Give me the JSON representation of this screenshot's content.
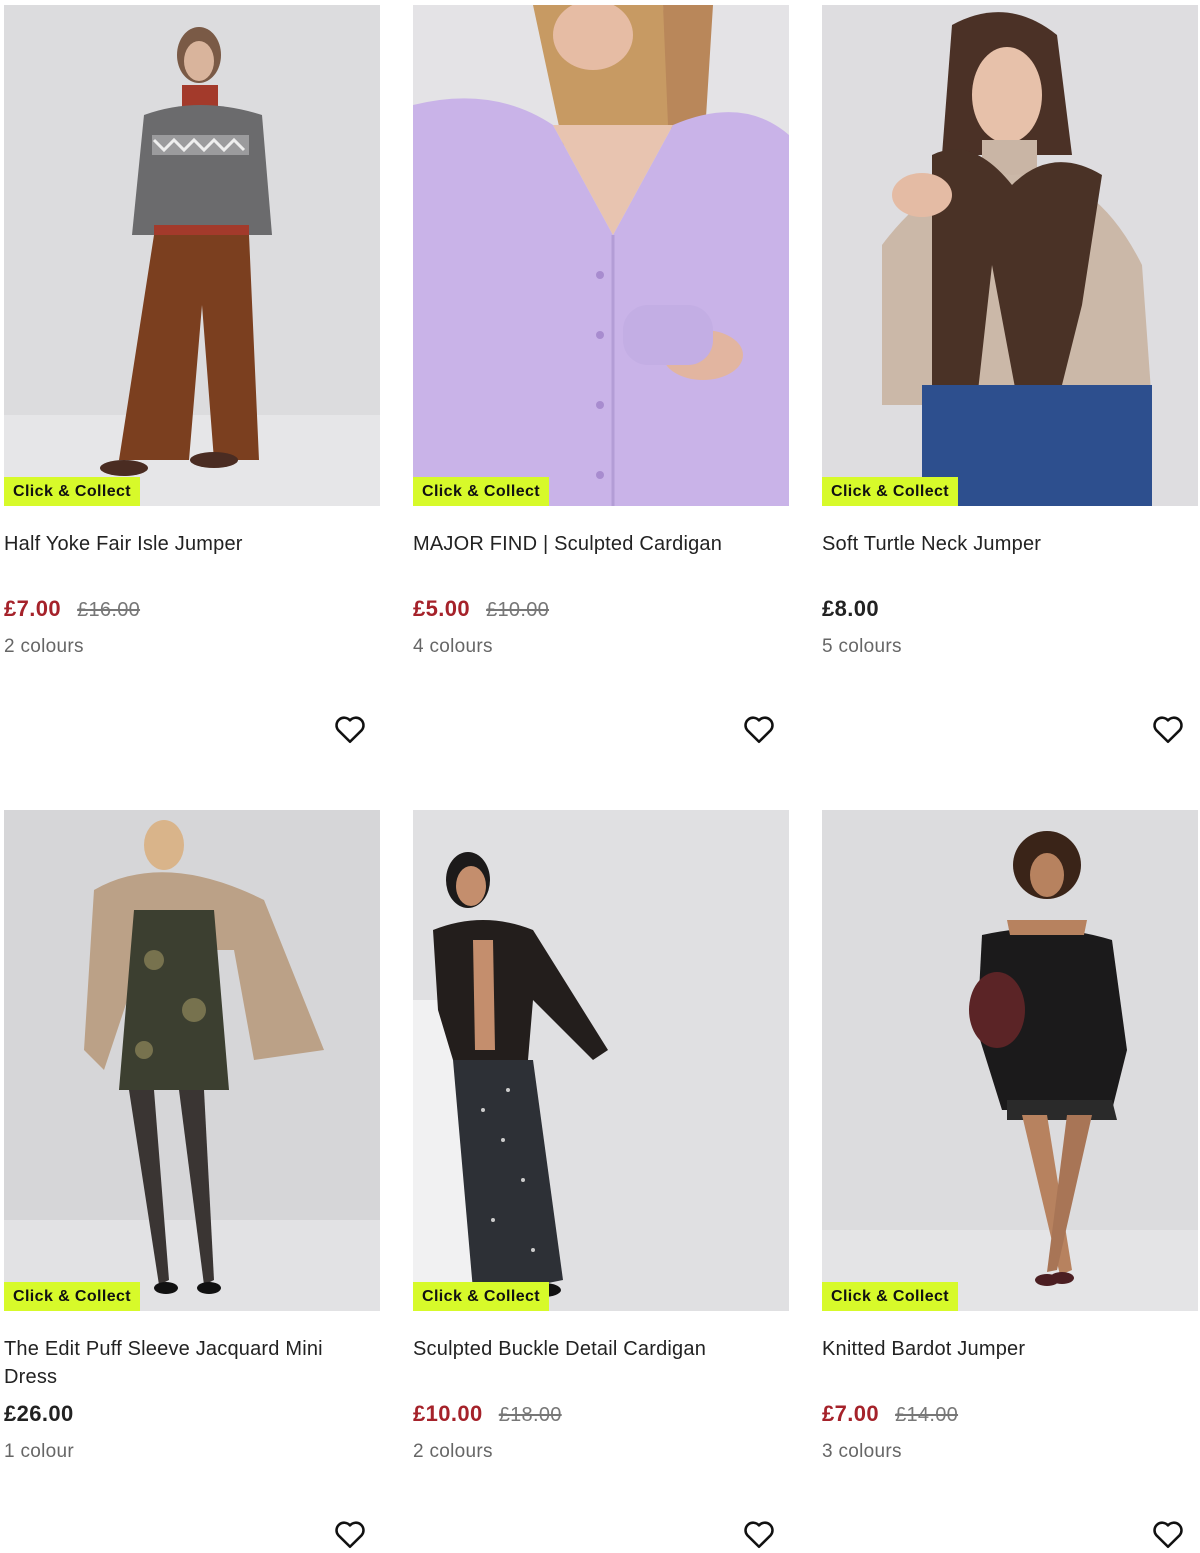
{
  "products": [
    {
      "title": "Half Yoke Fair Isle Jumper",
      "badge": "Click & Collect",
      "price": "£7.00",
      "was_price": "£16.00",
      "colours": "2 colours",
      "on_sale": true,
      "favourite_icon": "heart-outline-icon"
    },
    {
      "title": "MAJOR FIND | Sculpted Cardigan",
      "badge": "Click & Collect",
      "price": "£5.00",
      "was_price": "£10.00",
      "colours": "4 colours",
      "on_sale": true,
      "favourite_icon": "heart-outline-icon"
    },
    {
      "title": "Soft Turtle Neck Jumper",
      "badge": "Click & Collect",
      "price": "£8.00",
      "was_price": "",
      "colours": "5 colours",
      "on_sale": false,
      "favourite_icon": "heart-outline-icon"
    },
    {
      "title": "The Edit Puff Sleeve Jacquard Mini Dress",
      "badge": "Click & Collect",
      "price": "£26.00",
      "was_price": "",
      "colours": "1 colour",
      "on_sale": false,
      "favourite_icon": "heart-outline-icon"
    },
    {
      "title": "Sculpted Buckle Detail Cardigan",
      "badge": "Click & Collect",
      "price": "£10.00",
      "was_price": "£18.00",
      "colours": "2 colours",
      "on_sale": true,
      "favourite_icon": "heart-outline-icon"
    },
    {
      "title": "Knitted Bardot Jumper",
      "badge": "Click & Collect",
      "price": "£7.00",
      "was_price": "£14.00",
      "colours": "3 colours",
      "on_sale": true,
      "favourite_icon": "heart-outline-icon"
    }
  ],
  "colors": {
    "sale_price": "#a5222a",
    "badge_background": "#d7fa2a",
    "regular_price": "#222222",
    "was_price": "#777777"
  }
}
